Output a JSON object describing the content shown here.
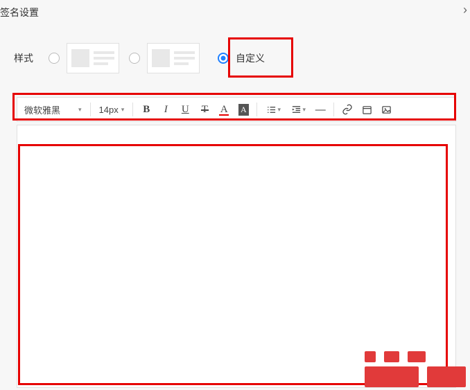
{
  "panel": {
    "title": "签名设置"
  },
  "styleRow": {
    "label": "样式",
    "customLabel": "自定义",
    "selected": "custom"
  },
  "toolbar": {
    "fontFamily": "微软雅黑",
    "fontSize": "14px",
    "bold": "B",
    "italic": "I",
    "underline": "U",
    "strike": "T",
    "fontColor": "A",
    "bgColor": "A"
  },
  "icons": {
    "caret": "▾",
    "dash": "—"
  },
  "highlights": {
    "accent": "#e60000"
  }
}
